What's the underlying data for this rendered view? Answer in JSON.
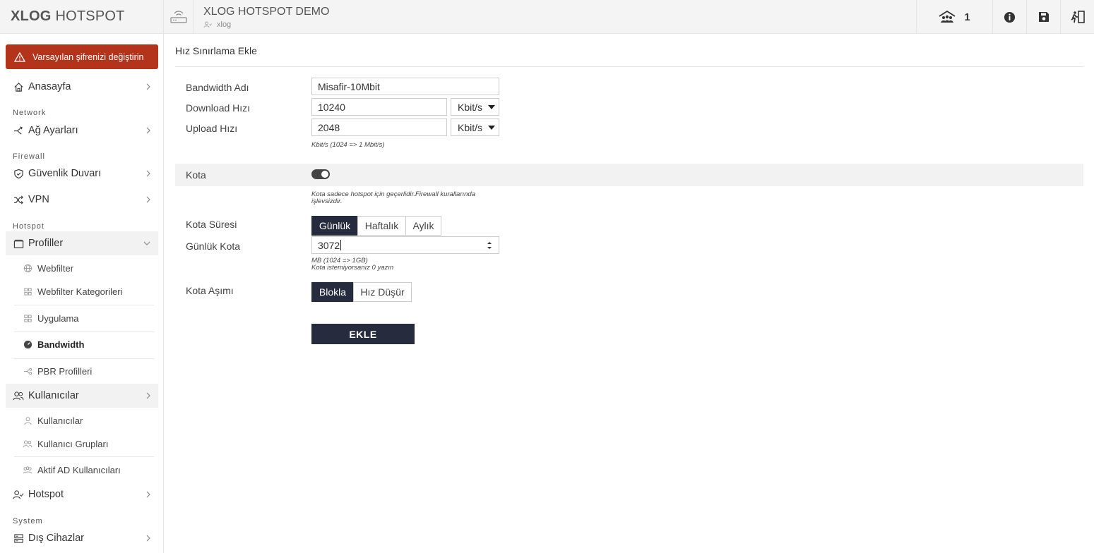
{
  "brand": {
    "bold": "XLOG",
    "rest": "HOTSPOT"
  },
  "alert": {
    "text": "Varsayılan şifrenizi değiştirin"
  },
  "sidebar": {
    "home": "Anasayfa",
    "section_network": "Network",
    "network_settings": "Ağ Ayarları",
    "section_firewall": "Firewall",
    "firewall": "Güvenlik Duvarı",
    "vpn": "VPN",
    "section_hotspot": "Hotspot",
    "profiles": "Profiller",
    "profile_items": [
      "Webfilter",
      "Webfilter Kategorileri",
      "Uygulama",
      "Bandwidth",
      "PBR Profilleri"
    ],
    "users": "Kullanıcılar",
    "user_items": [
      "Kullanıcılar",
      "Kullanıcı Grupları",
      "Aktif AD Kullanıcıları"
    ],
    "hotspot": "Hotspot",
    "section_system": "System",
    "external_devices": "Dış Cihazlar"
  },
  "header": {
    "title": "XLOG HOTSPOT DEMO",
    "user": "xlog",
    "online_count": "1"
  },
  "form": {
    "page_title": "Hız Sınırlama Ekle",
    "bandwidth_name_label": "Bandwidth Adı",
    "bandwidth_name_value": "Misafir-10Mbit",
    "download_label": "Download Hızı",
    "download_value": "10240",
    "download_unit": "Kbit/s",
    "upload_label": "Upload Hızı",
    "upload_value": "2048",
    "upload_unit": "Kbit/s",
    "speed_hint": "Kbit/s (1024 => 1 Mbit/s)",
    "quota_label": "Kota",
    "quota_enabled": true,
    "quota_hint_1": "Kota sadece hotspot için geçerlidir.Firewall kurallarında",
    "quota_hint_2": "işlevsizdir.",
    "quota_period_label": "Kota Süresi",
    "quota_period_options": [
      "Günlük",
      "Haftalık",
      "Aylık"
    ],
    "quota_period_selected": "Günlük",
    "daily_quota_label": "Günlük Kota",
    "daily_quota_value": "3072",
    "daily_quota_hint_1": "MB (1024 => 1GB)",
    "daily_quota_hint_2": "Kota istemiyorsanız 0 yazın",
    "overflow_label": "Kota Aşımı",
    "overflow_options": [
      "Blokla",
      "Hız Düşür"
    ],
    "overflow_selected": "Blokla",
    "submit": "EKLE"
  },
  "colors": {
    "accent_dark": "#262b3d",
    "alert_red": "#b3341b"
  }
}
